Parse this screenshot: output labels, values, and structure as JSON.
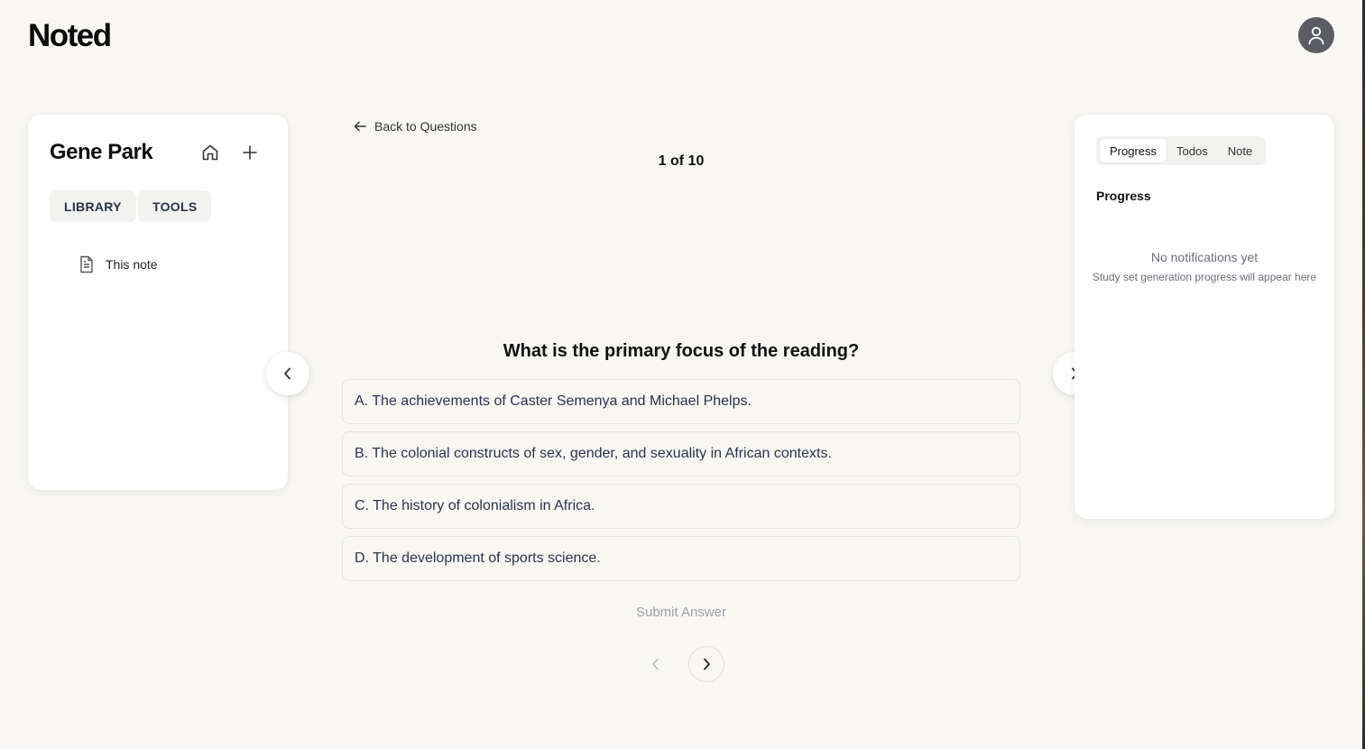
{
  "app": {
    "logo": "Noted"
  },
  "header": {
    "avatar_icon": "user-icon"
  },
  "sidebar": {
    "title": "Gene Park",
    "home_icon": "home-icon",
    "add_icon": "plus-icon",
    "chips": [
      {
        "label": "LIBRARY"
      },
      {
        "label": "TOOLS"
      }
    ],
    "items": [
      {
        "label": "This note",
        "icon": "document-icon"
      }
    ]
  },
  "main": {
    "back_label": "Back to Questions",
    "counter": "1 of 10",
    "question": "What is the primary focus of the reading?",
    "options": [
      {
        "label": "A. The achievements of Caster Semenya and Michael Phelps."
      },
      {
        "label": "B. The colonial constructs of sex, gender, and sexuality in African contexts."
      },
      {
        "label": "C. The history of colonialism in Africa."
      },
      {
        "label": "D. The development of sports science."
      }
    ],
    "submit_label": "Submit Answer"
  },
  "right_panel": {
    "tabs": [
      {
        "label": "Progress",
        "active": true
      },
      {
        "label": "Todos",
        "active": false
      },
      {
        "label": "Note",
        "active": false
      }
    ],
    "section_title": "Progress",
    "empty_title": "No notifications yet",
    "empty_subtitle": "Study set generation progress will appear here"
  },
  "colors": {
    "background": "#f8f7f4",
    "card": "#ffffff",
    "avatar": "#5b5d62",
    "muted_text": "#9aa0a8"
  }
}
